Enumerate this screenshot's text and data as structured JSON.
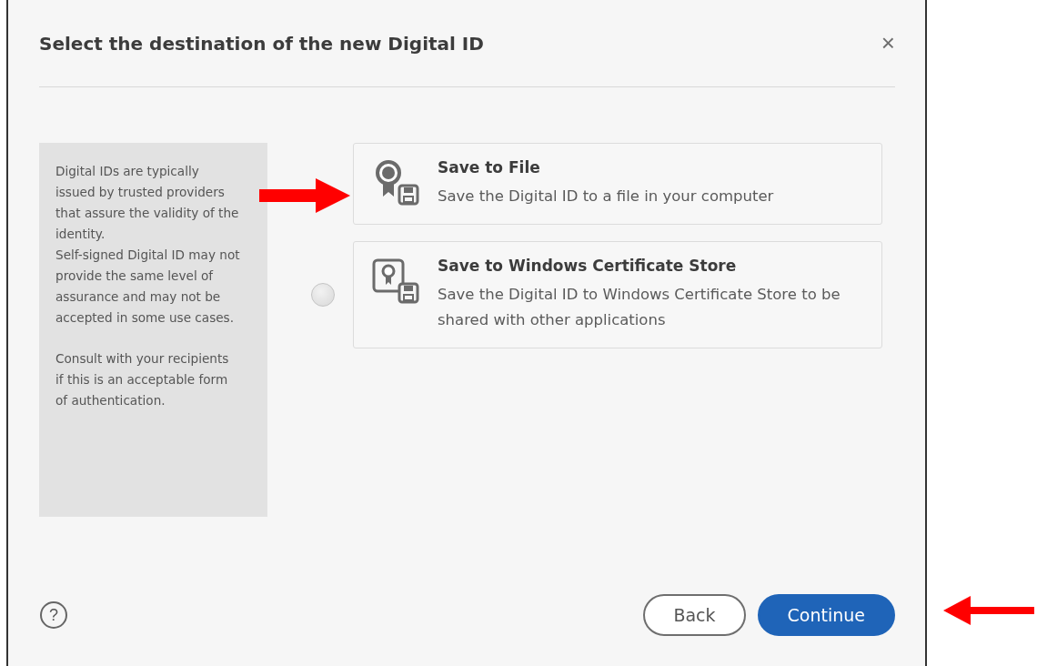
{
  "dialog": {
    "title": "Select the destination of the new Digital ID",
    "close": "×",
    "info_panel": [
      "Digital IDs are typically issued by trusted providers that assure the validity of the identity.\nSelf-signed Digital ID may not provide the same level of assurance and may not be accepted in some use cases.",
      "Consult with your recipients if this is an acceptable form of authentication."
    ],
    "options": [
      {
        "kind": "file",
        "title": "Save to File",
        "description": "Save the Digital ID to a file in your computer"
      },
      {
        "kind": "store",
        "title": "Save to Windows Certificate Store",
        "description": "Save the Digital ID to Windows Certificate Store to be shared with other applications",
        "selected": false
      }
    ],
    "help": "?",
    "buttons": [
      {
        "label": "Back",
        "kind": "secondary"
      },
      {
        "label": "Continue",
        "kind": "primary"
      }
    ]
  }
}
